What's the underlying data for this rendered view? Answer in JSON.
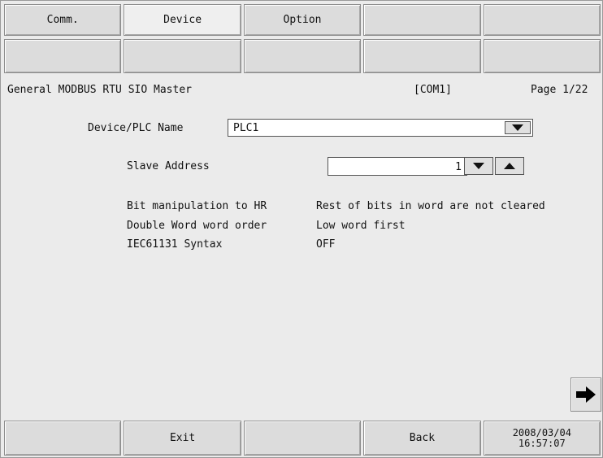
{
  "top_tabs": [
    {
      "label": "Comm."
    },
    {
      "label": "Device"
    },
    {
      "label": "Option"
    },
    {
      "label": ""
    },
    {
      "label": ""
    }
  ],
  "second_row": [
    "",
    "",
    "",
    "",
    ""
  ],
  "header": {
    "title": "General MODBUS RTU SIO Master",
    "port": "[COM1]",
    "page": "Page 1/22"
  },
  "device": {
    "label": "Device/PLC Name",
    "value": "PLC1",
    "dropdown_icon": "triangle-down-icon"
  },
  "slave": {
    "label": "Slave Address",
    "value": "1",
    "down_icon": "triangle-down-icon",
    "up_icon": "triangle-up-icon"
  },
  "settings": [
    {
      "label": "Bit manipulation to HR",
      "value": "Rest of bits in word are not cleared"
    },
    {
      "label": "Double Word word order",
      "value": "Low word first"
    },
    {
      "label": "IEC61131 Syntax",
      "value": "OFF"
    }
  ],
  "bottom": {
    "exit_label": "Exit",
    "back_label": "Back",
    "date": "2008/03/04",
    "time": "16:57:07"
  },
  "next_icon": "arrow-right-icon"
}
